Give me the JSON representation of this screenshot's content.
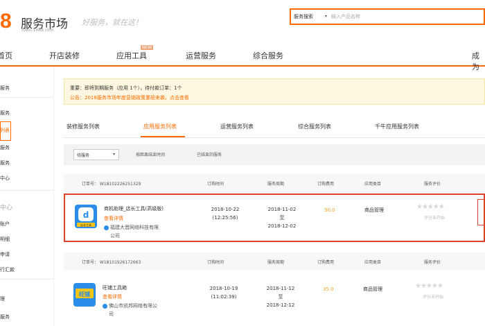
{
  "header": {
    "logo_number": "8",
    "logo_title": "服务市场",
    "logo_subtitle": "fuwu.1688.com",
    "slogan": "好服务，就在这！",
    "search_type": "服务搜索",
    "search_caret": "▾",
    "search_placeholder": "输入产品名称"
  },
  "nav": {
    "items": [
      "首页",
      "开店装修",
      "应用工具",
      "运营服务",
      "综合服务",
      "成为"
    ],
    "badge": "NEW"
  },
  "sidebar": {
    "items": [
      "服务",
      "服务",
      "列表",
      "服务",
      "服务",
      "中心",
      "中心",
      "账户",
      "明细",
      "申请",
      "行汇款",
      "理",
      "服务"
    ]
  },
  "notice": {
    "line1": "重要：即将到期服务（应用 1个），待付款订单：1个",
    "line2": "公告：2018服务市场年度营销政策重磅来袭，点击查看"
  },
  "tabs": [
    "装修服务列表",
    "应用服务列表",
    "运营服务列表",
    "综合服务列表",
    "千牛应用服务列表"
  ],
  "filter": {
    "select_value": "待服务",
    "caret": "▾",
    "button1": "按距离结束时间",
    "button2": "已结束的服务"
  },
  "columns": [
    "订购时间",
    "服务周期",
    "订购费用",
    "应用类目",
    "服务评价"
  ],
  "orders": [
    {
      "order_no": "订单号：  W18102226251329",
      "icon_label": "店长工具",
      "name": "商机助理_店长工具(高级版)",
      "link": "查看详情",
      "vendor_line1": "福建大晋网络科技有限",
      "vendor_line2": "公司",
      "order_date": "2018-10-22",
      "order_time": "(12:25:56)",
      "start": "2018-11-02",
      "to": "至",
      "end": "2018-12-02",
      "price": "30.0",
      "category": "商品管理",
      "stars": "★★★★★",
      "rating_text": "评分未开始"
    },
    {
      "order_no": "订单号：  W18101926172663",
      "icon_label": "旺铺",
      "name": "旺铺工具箱",
      "link": "查看详情",
      "vendor_line1": "佛山市凯邦网络有限公",
      "vendor_line2": "司",
      "order_date": "2018-10-19",
      "order_time": "(11:02:39)",
      "start": "2018-11-12",
      "to": "至",
      "end": "2018-12-12",
      "price": "35.0",
      "category": "商品管理",
      "stars": "★★★★★",
      "rating_text": "评分未开始"
    }
  ],
  "colors": {
    "accent": "#ff6a00",
    "highlight_border": "#e0412b",
    "price": "#f5a623",
    "notice_bg": "#fff8e1"
  }
}
